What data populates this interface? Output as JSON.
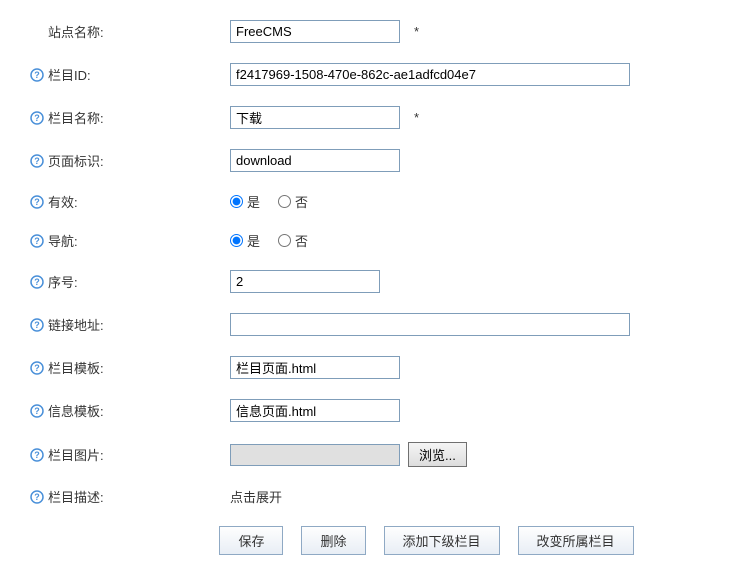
{
  "fields": {
    "site_name": {
      "label": "站点名称:",
      "value": "FreeCMS",
      "required": true
    },
    "column_id": {
      "label": "栏目ID:",
      "value": "f2417969-1508-470e-862c-ae1adfcd04e7"
    },
    "column_name": {
      "label": "栏目名称:",
      "value": "下载",
      "required": true
    },
    "page_identifier": {
      "label": "页面标识:",
      "value": "download"
    },
    "enabled": {
      "label": "有效:",
      "yes": "是",
      "no": "否",
      "value": "yes"
    },
    "navigation": {
      "label": "导航:",
      "yes": "是",
      "no": "否",
      "value": "yes"
    },
    "order_number": {
      "label": "序号:",
      "value": "2"
    },
    "link_address": {
      "label": "链接地址:",
      "value": ""
    },
    "column_template": {
      "label": "栏目模板:",
      "value": "栏目页面.html"
    },
    "info_template": {
      "label": "信息模板:",
      "value": "信息页面.html"
    },
    "column_image": {
      "label": "栏目图片:",
      "browse": "浏览..."
    },
    "column_desc": {
      "label": "栏目描述:",
      "expand": "点击展开"
    }
  },
  "buttons": {
    "save": "保存",
    "delete": "删除",
    "add_sub": "添加下级栏目",
    "change_parent": "改变所属栏目"
  },
  "required_mark": "*"
}
